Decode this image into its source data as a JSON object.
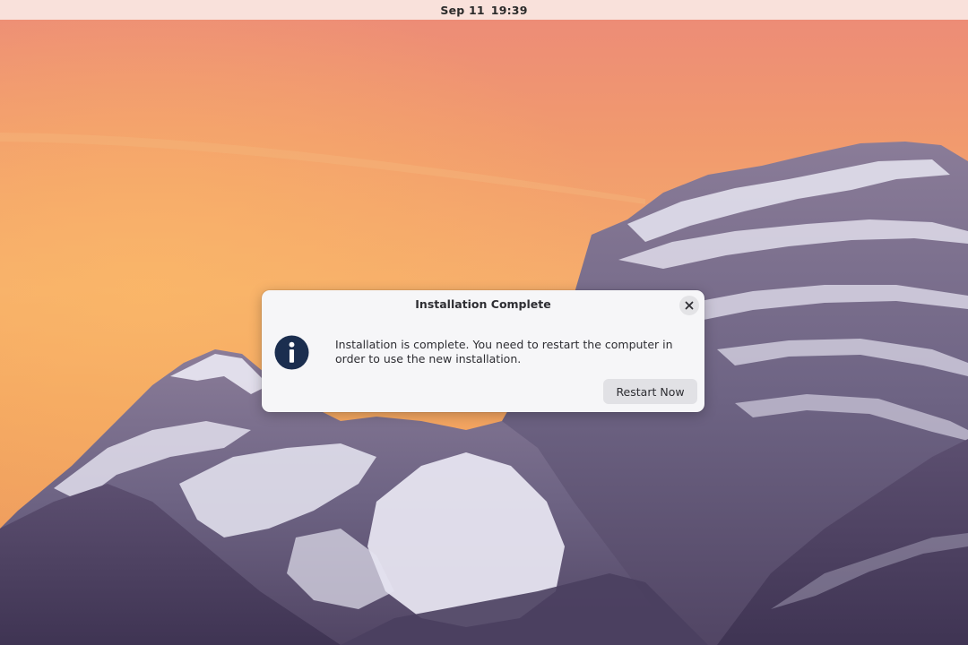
{
  "top_bar": {
    "date": "Sep 11",
    "time": "19:39"
  },
  "dialog": {
    "title": "Installation Complete",
    "message": "Installation is complete. You need to restart the computer in order to use the new installation.",
    "primary_button_label": "Restart Now",
    "icon": "info-icon",
    "close_icon": "close-icon"
  },
  "colors": {
    "sky_top": "#ec8a78",
    "sky_mid": "#f6ad6c",
    "mountain_rock": "#6e6484",
    "mountain_dark": "#4a3f5f",
    "snow": "#e8e6f2",
    "dialog_bg": "#f6f6f8",
    "info_icon": "#1b2e4f"
  }
}
